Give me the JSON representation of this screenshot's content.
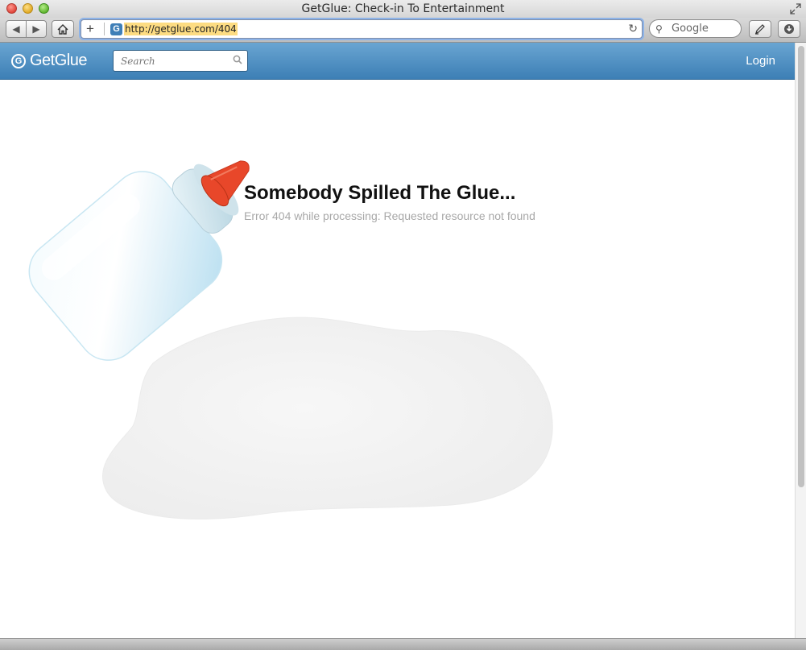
{
  "window": {
    "title": "GetGlue: Check-in To Entertainment"
  },
  "toolbar": {
    "url": "http://getglue.com/404",
    "search_placeholder": "Google",
    "favicon_letter": "G",
    "icons": [
      "back-icon",
      "forward-icon",
      "home-icon",
      "plus-icon",
      "reload-icon",
      "search-icon",
      "pen-icon",
      "download-icon"
    ]
  },
  "site": {
    "logo_text": "GetGlue",
    "logo_mark": "G",
    "search_placeholder": "Search",
    "login_label": "Login"
  },
  "error": {
    "heading": "Somebody Spilled The Glue...",
    "message": "Error 404 while processing: Requested resource not found"
  },
  "colors": {
    "header_blue": "#4f8fc4",
    "cap_red": "#e8472a",
    "url_highlight": "#fddc82"
  }
}
